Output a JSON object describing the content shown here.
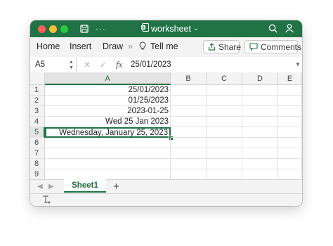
{
  "app": {
    "title": "worksheet",
    "title_chevron": "⌄",
    "accent": "#217346"
  },
  "ribbon": {
    "tabs": [
      "Home",
      "Insert",
      "Draw"
    ],
    "more": "»",
    "tell_me": "Tell me",
    "share_label": "Share",
    "comments_label": "Comments"
  },
  "formula_bar": {
    "name_box": "A5",
    "fx": "fx",
    "formula": "25/01/2023"
  },
  "grid": {
    "columns": [
      "A",
      "B",
      "C",
      "D",
      "E"
    ],
    "rows": [
      "1",
      "2",
      "3",
      "4",
      "5",
      "6",
      "7",
      "8",
      "9"
    ],
    "cells_a": [
      "25/01/2023",
      "01/25/2023",
      "2023-01-25",
      "Wed 25 Jan 2023",
      "Wednesday, January 25, 2023",
      "",
      "",
      "",
      ""
    ],
    "active_cell": "A5"
  },
  "sheets": {
    "tabs": [
      "Sheet1"
    ],
    "add_label": "+"
  }
}
